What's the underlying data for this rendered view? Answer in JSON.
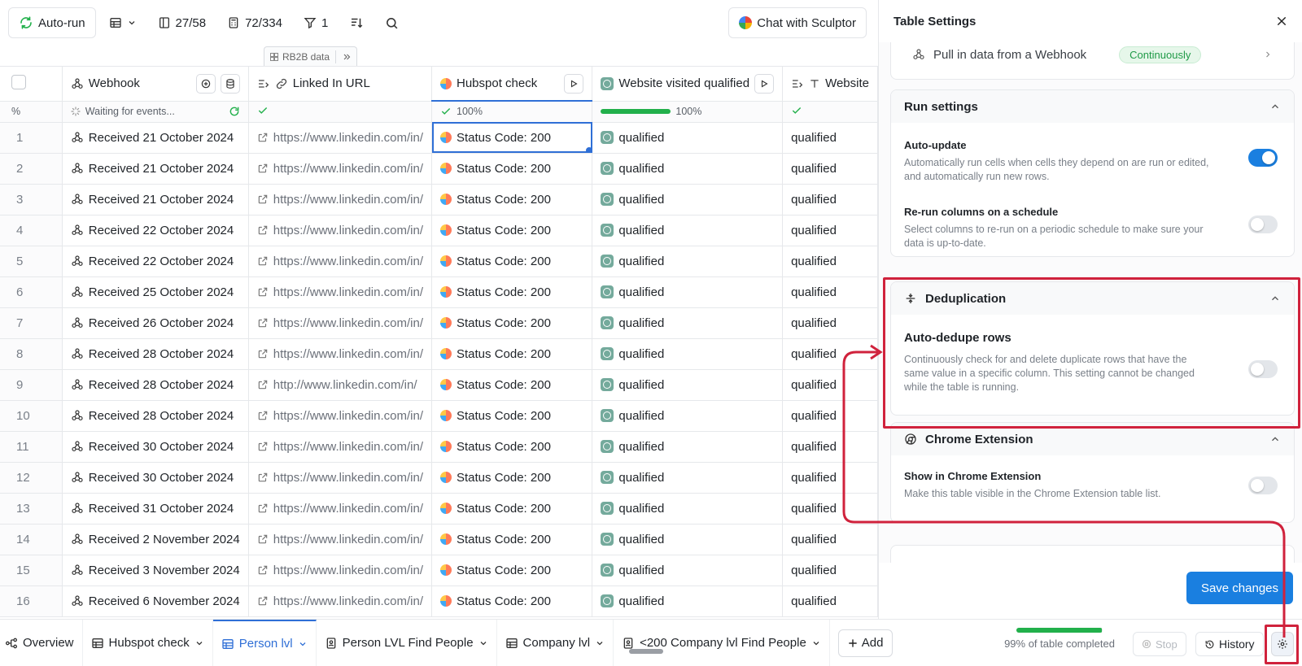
{
  "toolbar": {
    "autorun_label": "Auto-run",
    "rows_count": "27/58",
    "cells_count": "72/334",
    "filter_count": "1",
    "chat_label": "Chat with Sculptor"
  },
  "grid": {
    "group_label": "RB2B data",
    "rownum_header": "%",
    "columns": [
      {
        "label": "Webhook",
        "status": "Waiting for events..."
      },
      {
        "label": "Linked In URL",
        "status": ""
      },
      {
        "label": "Hubspot check",
        "status": "100%"
      },
      {
        "label": "Website visited qualified",
        "status": "100%",
        "progress": 100
      },
      {
        "label": "Website",
        "status": ""
      }
    ],
    "rows": [
      {
        "n": "1",
        "webhook": "Received 21 October 2024",
        "linkedin": "https://www.linkedin.com/in/",
        "hubspot": "Status Code: 200",
        "visited": "qualified",
        "website": "qualified"
      },
      {
        "n": "2",
        "webhook": "Received 21 October 2024",
        "linkedin": "https://www.linkedin.com/in/",
        "hubspot": "Status Code: 200",
        "visited": "qualified",
        "website": "qualified"
      },
      {
        "n": "3",
        "webhook": "Received 21 October 2024",
        "linkedin": "https://www.linkedin.com/in/",
        "hubspot": "Status Code: 200",
        "visited": "qualified",
        "website": "qualified"
      },
      {
        "n": "4",
        "webhook": "Received 22 October 2024",
        "linkedin": "https://www.linkedin.com/in/",
        "hubspot": "Status Code: 200",
        "visited": "qualified",
        "website": "qualified"
      },
      {
        "n": "5",
        "webhook": "Received 22 October 2024",
        "linkedin": "https://www.linkedin.com/in/",
        "hubspot": "Status Code: 200",
        "visited": "qualified",
        "website": "qualified"
      },
      {
        "n": "6",
        "webhook": "Received 25 October 2024",
        "linkedin": "https://www.linkedin.com/in/",
        "hubspot": "Status Code: 200",
        "visited": "qualified",
        "website": "qualified"
      },
      {
        "n": "7",
        "webhook": "Received 26 October 2024",
        "linkedin": "https://www.linkedin.com/in/",
        "hubspot": "Status Code: 200",
        "visited": "qualified",
        "website": "qualified"
      },
      {
        "n": "8",
        "webhook": "Received 28 October 2024",
        "linkedin": "https://www.linkedin.com/in/",
        "hubspot": "Status Code: 200",
        "visited": "qualified",
        "website": "qualified"
      },
      {
        "n": "9",
        "webhook": "Received 28 October 2024",
        "linkedin": "http://www.linkedin.com/in/",
        "hubspot": "Status Code: 200",
        "visited": "qualified",
        "website": "qualified"
      },
      {
        "n": "10",
        "webhook": "Received 28 October 2024",
        "linkedin": "https://www.linkedin.com/in/",
        "hubspot": "Status Code: 200",
        "visited": "qualified",
        "website": "qualified"
      },
      {
        "n": "11",
        "webhook": "Received 30 October 2024",
        "linkedin": "https://www.linkedin.com/in/",
        "hubspot": "Status Code: 200",
        "visited": "qualified",
        "website": "qualified"
      },
      {
        "n": "12",
        "webhook": "Received 30 October 2024",
        "linkedin": "https://www.linkedin.com/in/",
        "hubspot": "Status Code: 200",
        "visited": "qualified",
        "website": "qualified"
      },
      {
        "n": "13",
        "webhook": "Received 31 October 2024",
        "linkedin": "https://www.linkedin.com/in/",
        "hubspot": "Status Code: 200",
        "visited": "qualified",
        "website": "qualified"
      },
      {
        "n": "14",
        "webhook": "Received 2 November 2024",
        "linkedin": "https://www.linkedin.com/in/",
        "hubspot": "Status Code: 200",
        "visited": "qualified",
        "website": "qualified"
      },
      {
        "n": "15",
        "webhook": "Received 3 November 2024",
        "linkedin": "https://www.linkedin.com/in/",
        "hubspot": "Status Code: 200",
        "visited": "qualified",
        "website": "qualified"
      },
      {
        "n": "16",
        "webhook": "Received 6 November 2024",
        "linkedin": "https://www.linkedin.com/in/",
        "hubspot": "Status Code: 200",
        "visited": "qualified",
        "website": "qualified"
      }
    ]
  },
  "tabs": {
    "overview": "Overview",
    "items": [
      "Hubspot check",
      "Person lvl",
      "Person LVL Find People",
      "Company lvl",
      "<200 Company lvl Find People"
    ],
    "active_index": 1,
    "add_label": "Add"
  },
  "footer": {
    "completion_label": "99% of table completed",
    "completion_value": 99,
    "stop_label": "Stop",
    "history_label": "History"
  },
  "panel": {
    "title": "Table Settings",
    "webhook_source": "Pull in data from a Webhook",
    "webhook_mode": "Continuously",
    "run_settings": {
      "title": "Run settings",
      "auto_update_name": "Auto-update",
      "auto_update_desc": "Automatically run cells when cells they depend on are run or edited, and automatically run new rows.",
      "auto_update_on": true,
      "schedule_name": "Re-run columns on a schedule",
      "schedule_desc": "Select columns to re-run on a periodic schedule to make sure your data is up-to-date.",
      "schedule_on": false
    },
    "dedup": {
      "title": "Deduplication",
      "name": "Auto-dedupe rows",
      "desc": "Continuously check for and delete duplicate rows that have the same value in a specific column. This setting cannot be changed while the table is running.",
      "on": false
    },
    "chrome": {
      "title": "Chrome Extension",
      "name": "Show in Chrome Extension",
      "desc": "Make this table visible in the Chrome Extension table list.",
      "on": false
    },
    "save_label": "Save changes"
  },
  "colors": {
    "accent": "#1a7fe0",
    "highlight": "#d0223c",
    "success": "#22b04b"
  }
}
